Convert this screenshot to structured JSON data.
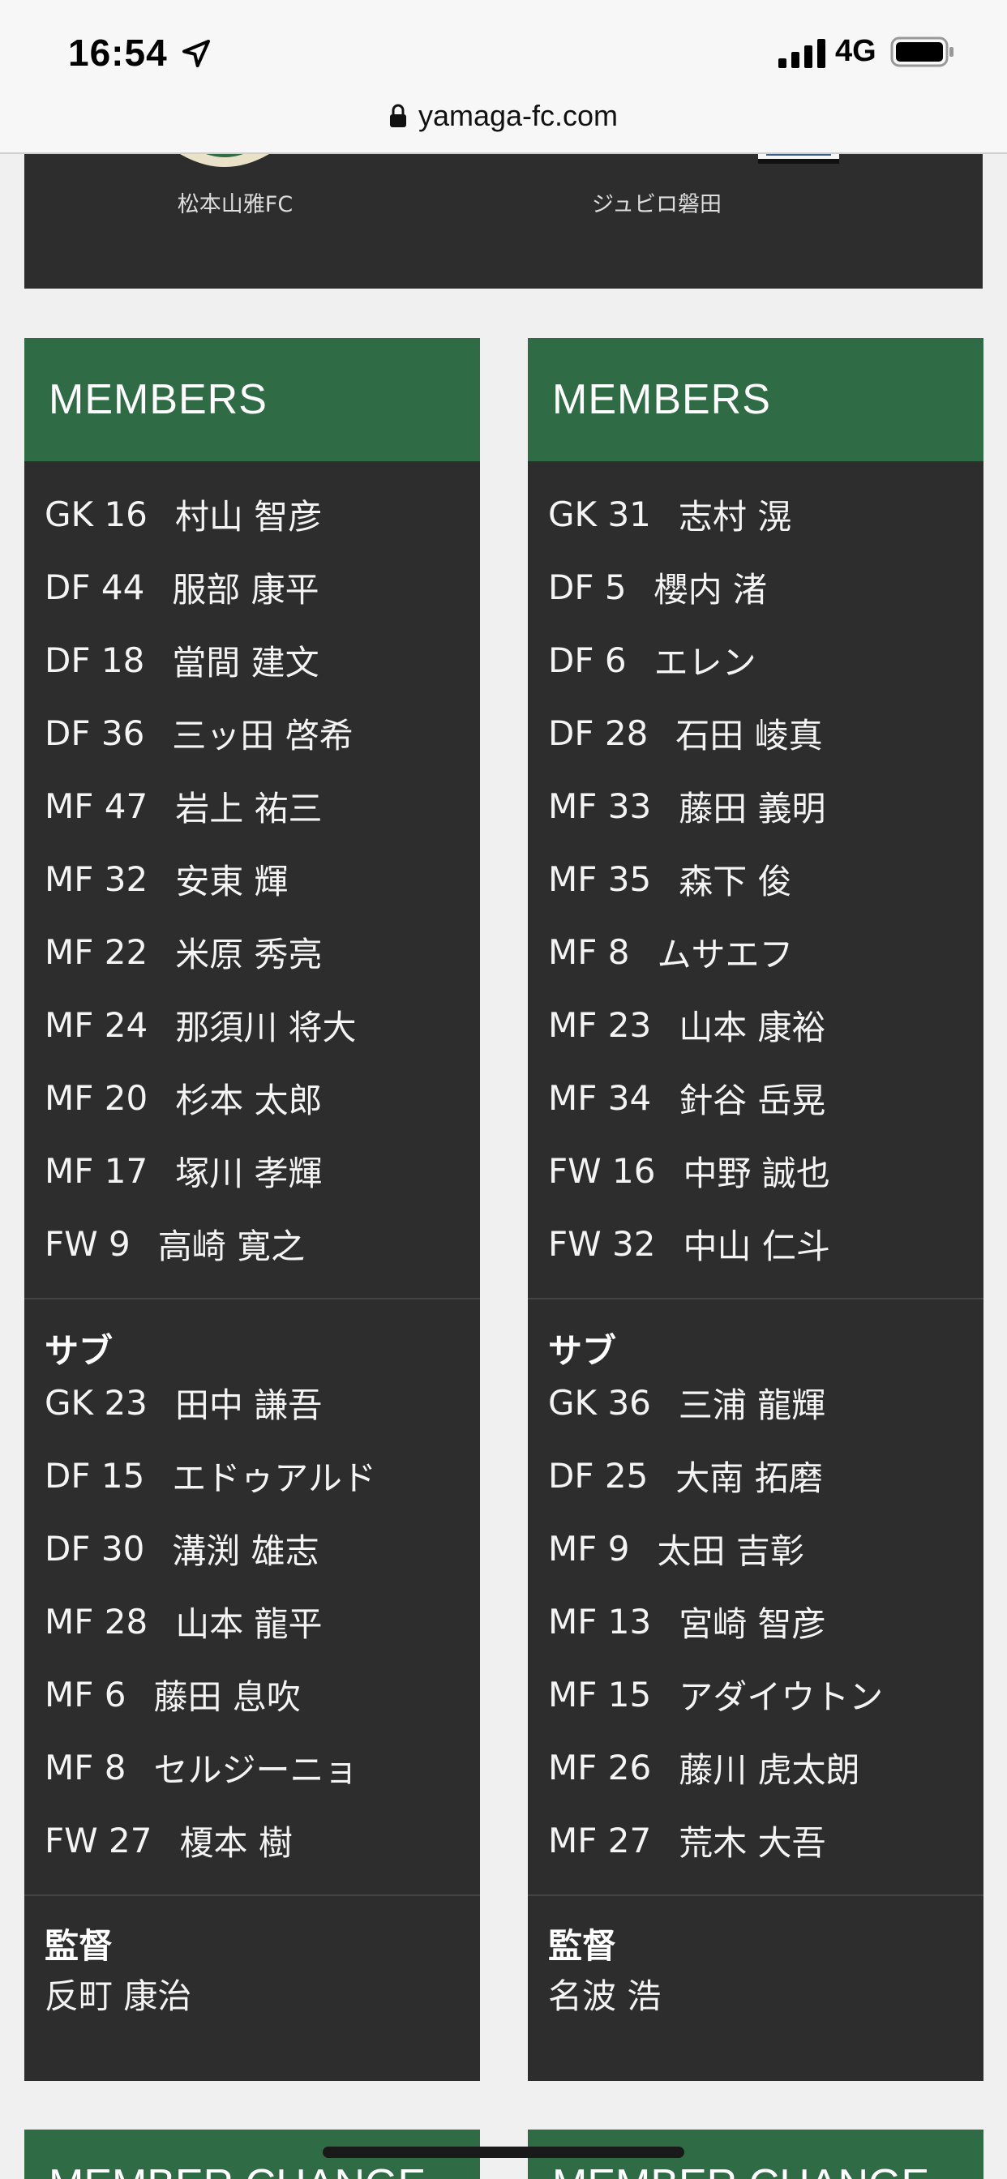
{
  "status": {
    "time": "16:54",
    "network": "4G"
  },
  "browser": {
    "url": "yamaga-fc.com"
  },
  "match": {
    "home_team": "松本山雅FC",
    "away_team": "ジュビロ磐田"
  },
  "home": {
    "heading": "MEMBERS",
    "starters": [
      {
        "pos": "GK 16",
        "name": "村山 智彦"
      },
      {
        "pos": "DF 44",
        "name": "服部 康平"
      },
      {
        "pos": "DF 18",
        "name": "當間 建文"
      },
      {
        "pos": "DF 36",
        "name": "三ッ田 啓希"
      },
      {
        "pos": "MF 47",
        "name": "岩上 祐三"
      },
      {
        "pos": "MF 32",
        "name": "安東 輝"
      },
      {
        "pos": "MF 22",
        "name": "米原 秀亮"
      },
      {
        "pos": "MF 24",
        "name": "那須川 将大"
      },
      {
        "pos": "MF 20",
        "name": "杉本 太郎"
      },
      {
        "pos": "MF 17",
        "name": "塚川 孝輝"
      },
      {
        "pos": "FW 9",
        "name": "高崎 寛之"
      }
    ],
    "subs_heading": "サブ",
    "subs": [
      {
        "pos": "GK 23",
        "name": "田中 謙吾"
      },
      {
        "pos": "DF 15",
        "name": "エドゥアルド"
      },
      {
        "pos": "DF 30",
        "name": "溝渕 雄志"
      },
      {
        "pos": "MF 28",
        "name": "山本 龍平"
      },
      {
        "pos": "MF 6",
        "name": "藤田 息吹"
      },
      {
        "pos": "MF 8",
        "name": "セルジーニョ"
      },
      {
        "pos": "FW 27",
        "name": "榎本 樹"
      }
    ],
    "coach_heading": "監督",
    "coach": "反町 康治",
    "change_heading": "MEMBER CHANGE"
  },
  "away": {
    "heading": "MEMBERS",
    "starters": [
      {
        "pos": "GK 31",
        "name": "志村 滉"
      },
      {
        "pos": "DF 5",
        "name": "櫻内 渚"
      },
      {
        "pos": "DF 6",
        "name": "エレン"
      },
      {
        "pos": "DF 28",
        "name": "石田 崚真"
      },
      {
        "pos": "MF 33",
        "name": "藤田 義明"
      },
      {
        "pos": "MF 35",
        "name": "森下 俊"
      },
      {
        "pos": "MF 8",
        "name": "ムサエフ"
      },
      {
        "pos": "MF 23",
        "name": "山本 康裕"
      },
      {
        "pos": "MF 34",
        "name": "針谷 岳晃"
      },
      {
        "pos": "FW 16",
        "name": "中野 誠也"
      },
      {
        "pos": "FW 32",
        "name": "中山 仁斗"
      }
    ],
    "subs_heading": "サブ",
    "subs": [
      {
        "pos": "GK 36",
        "name": "三浦 龍輝"
      },
      {
        "pos": "DF 25",
        "name": "大南 拓磨"
      },
      {
        "pos": "MF 9",
        "name": "太田 吉彰"
      },
      {
        "pos": "MF 13",
        "name": "宮崎 智彦"
      },
      {
        "pos": "MF 15",
        "name": "アダイウトン"
      },
      {
        "pos": "MF 26",
        "name": "藤川 虎太朗"
      },
      {
        "pos": "MF 27",
        "name": "荒木 大吾"
      }
    ],
    "coach_heading": "監督",
    "coach": "名波 浩",
    "change_heading": "MEMBER CHANGE"
  },
  "colors": {
    "panel_bg": "#2d2d2d",
    "header_green": "#2f6b44",
    "page_bg": "#f0f0f0"
  }
}
